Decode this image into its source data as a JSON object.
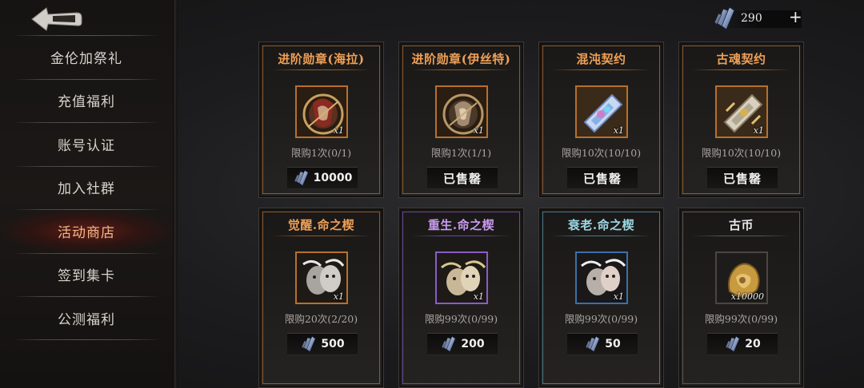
{
  "currency": {
    "amount": "290",
    "plus": "+"
  },
  "sidebar": {
    "items": [
      {
        "label": "金伦加祭礼",
        "active": false
      },
      {
        "label": "充值福利",
        "active": false
      },
      {
        "label": "账号认证",
        "active": false
      },
      {
        "label": "加入社群",
        "active": false
      },
      {
        "label": "活动商店",
        "active": true
      },
      {
        "label": "签到集卡",
        "active": false
      },
      {
        "label": "公测福利",
        "active": false
      }
    ]
  },
  "cards": [
    {
      "title": "进阶勋章(海拉)",
      "qty": "x1",
      "limit": "限购1次(0/1)",
      "price": "10000",
      "sold": ""
    },
    {
      "title": "进阶勋章(伊丝特)",
      "qty": "x1",
      "limit": "限购1次(1/1)",
      "price": "",
      "sold": "已售罄"
    },
    {
      "title": "混沌契约",
      "qty": "x1",
      "limit": "限购10次(10/10)",
      "price": "",
      "sold": "已售罄"
    },
    {
      "title": "古魂契约",
      "qty": "x1",
      "limit": "限购10次(10/10)",
      "price": "",
      "sold": "已售罄"
    },
    {
      "title": "觉醒.命之楔",
      "qty": "x1",
      "limit": "限购20次(2/20)",
      "price": "500",
      "sold": ""
    },
    {
      "title": "重生.命之楔",
      "qty": "x1",
      "limit": "限购99次(0/99)",
      "price": "200",
      "sold": ""
    },
    {
      "title": "衰老.命之楔",
      "qty": "x1",
      "limit": "限购99次(0/99)",
      "price": "50",
      "sold": ""
    },
    {
      "title": "古币",
      "qty": "x10000",
      "limit": "限购99次(0/99)",
      "price": "20",
      "sold": ""
    }
  ]
}
